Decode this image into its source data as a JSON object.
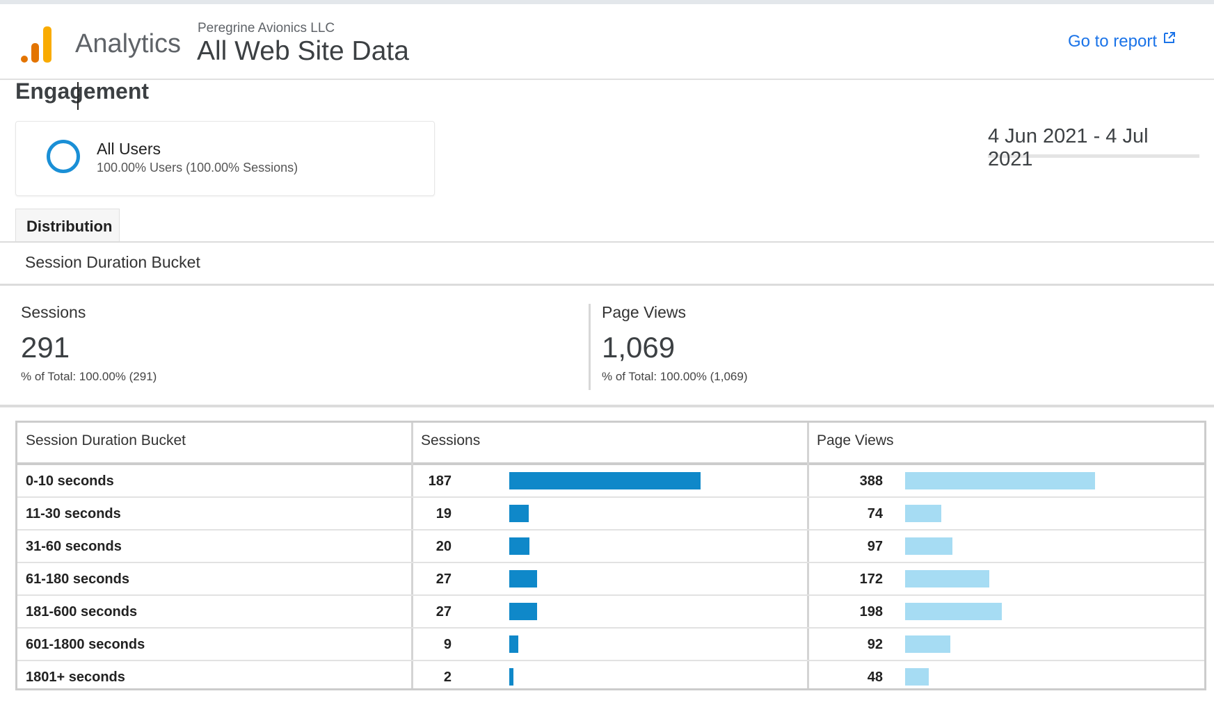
{
  "header": {
    "app_name": "Analytics",
    "organization": "Peregrine Avionics LLC",
    "view_name": "All Web Site Data",
    "goto_report": "Go to report"
  },
  "page": {
    "title": "Engagement"
  },
  "segment": {
    "name": "All Users",
    "detail": "100.00% Users (100.00% Sessions)",
    "color": "#1a8fd6"
  },
  "date_range": "4 Jun 2021 - 4 Jul 2021",
  "tabs": [
    {
      "label": "Distribution",
      "active": true
    }
  ],
  "dimension_label": "Session Duration Bucket",
  "metrics": [
    {
      "label": "Sessions",
      "value": "291",
      "total": "% of Total: 100.00% (291)"
    },
    {
      "label": "Page Views",
      "value": "1,069",
      "total": "% of Total: 100.00% (1,069)"
    }
  ],
  "table": {
    "headers": [
      "Session Duration Bucket",
      "Sessions",
      "Page Views"
    ],
    "colors": {
      "sessions_bar": "#0f88c9",
      "pageviews_bar": "#a6dcf3"
    },
    "rows": [
      {
        "bucket": "0-10 seconds",
        "sessions": 187,
        "pageviews": 388
      },
      {
        "bucket": "11-30 seconds",
        "sessions": 19,
        "pageviews": 74
      },
      {
        "bucket": "31-60 seconds",
        "sessions": 20,
        "pageviews": 97
      },
      {
        "bucket": "61-180 seconds",
        "sessions": 27,
        "pageviews": 172
      },
      {
        "bucket": "181-600 seconds",
        "sessions": 27,
        "pageviews": 198
      },
      {
        "bucket": "601-1800 seconds",
        "sessions": 9,
        "pageviews": 92
      },
      {
        "bucket": "1801+ seconds",
        "sessions": 2,
        "pageviews": 48
      }
    ]
  },
  "icons": {
    "logo": "analytics-logo-icon",
    "external": "external-link-icon",
    "segment": "segment-circle-icon"
  }
}
